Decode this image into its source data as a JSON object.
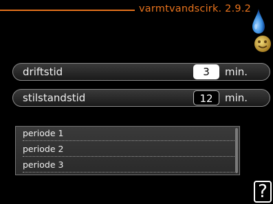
{
  "header": {
    "title": "varmtvandscirk. 2.9.2"
  },
  "icons": {
    "drop": "water-drop-icon",
    "smiley": "smiley-icon",
    "help": "help-icon"
  },
  "rows": [
    {
      "label": "driftstid",
      "value": "3",
      "unit": "min."
    },
    {
      "label": "stilstandstid",
      "value": "12",
      "unit": "min."
    }
  ],
  "periods": [
    "periode 1",
    "periode 2",
    "periode 3"
  ],
  "help": {
    "label": "?"
  },
  "colors": {
    "accent": "#e8731d",
    "drop": "#3a8fe0",
    "smiley": "#d9b84a"
  }
}
